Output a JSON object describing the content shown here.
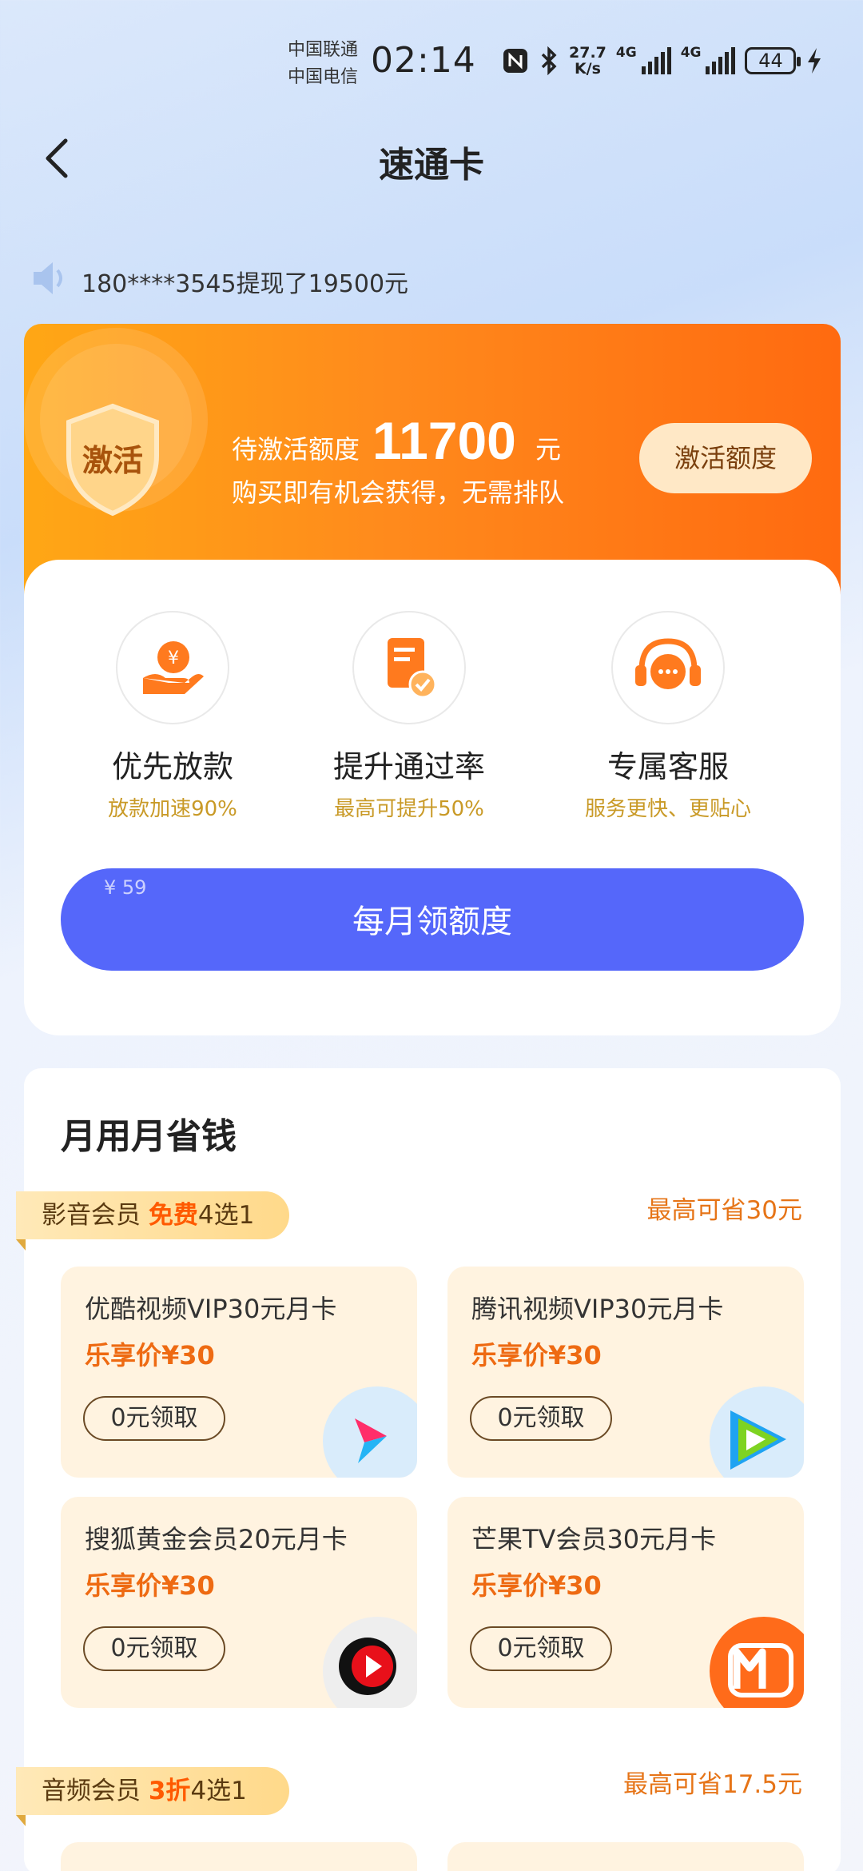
{
  "status_bar": {
    "carrier1": "中国联通",
    "carrier2": "中国电信",
    "time": "02:14",
    "speed_value": "27.7",
    "speed_unit": "K/s",
    "net1": "4G",
    "net2": "4G",
    "battery": "44"
  },
  "nav": {
    "title": "速通卡"
  },
  "notice": {
    "text": "180****3545提现了19500元"
  },
  "banner": {
    "badge": "激活",
    "pending_label": "待激活额度",
    "pending_amount": "11700",
    "pending_unit": "元",
    "subtitle": "购买即有机会获得，无需排队",
    "activate_label": "激活额度"
  },
  "features": [
    {
      "title": "优先放款",
      "sub": "放款加速90%",
      "icon": "coin-hand-icon"
    },
    {
      "title": "提升通过率",
      "sub": "最高可提升50%",
      "icon": "document-check-icon"
    },
    {
      "title": "专属客服",
      "sub": "服务更快、更贴心",
      "icon": "headset-chat-icon"
    }
  ],
  "cta": {
    "price": "¥ 59",
    "label": "每月领额度"
  },
  "savings": {
    "title": "月用月省钱",
    "video": {
      "ribbon_prefix": "影音会员 ",
      "ribbon_highlight": "免费",
      "ribbon_suffix": "4选1",
      "max_save": "最高可省30元",
      "cards": [
        {
          "title": "优酷视频VIP30元月卡",
          "price": "乐享价¥30",
          "button": "0元领取",
          "logo": "youku-logo-icon"
        },
        {
          "title": "腾讯视频VIP30元月卡",
          "price": "乐享价¥30",
          "button": "0元领取",
          "logo": "tencent-video-logo-icon"
        },
        {
          "title": "搜狐黄金会员20元月卡",
          "price": "乐享价¥30",
          "button": "0元领取",
          "logo": "sohu-video-logo-icon"
        },
        {
          "title": "芒果TV会员30元月卡",
          "price": "乐享价¥30",
          "button": "0元领取",
          "logo": "mango-tv-logo-icon"
        }
      ]
    },
    "audio": {
      "ribbon_prefix": "音频会员 ",
      "ribbon_highlight": "3折",
      "ribbon_suffix": "4选1",
      "max_save": "最高可省17.5元"
    }
  },
  "colors": {
    "orange_start": "#ffa715",
    "orange_end": "#ff6a10",
    "cta_blue": "#5567fa",
    "gold_text": "#c99a27",
    "price_orange": "#ee6a12"
  }
}
